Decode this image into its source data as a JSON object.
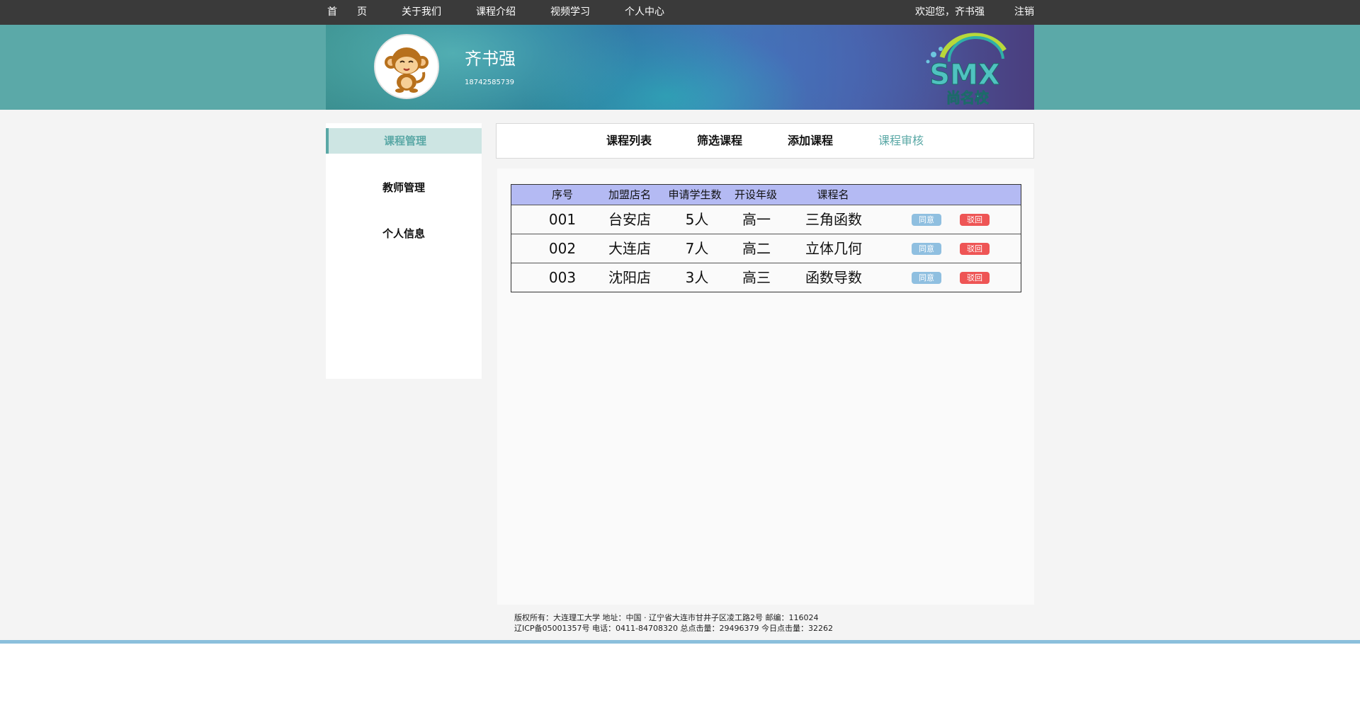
{
  "nav": {
    "items": [
      "首　　页",
      "关于我们",
      "课程介绍",
      "视频学习",
      "个人中心"
    ],
    "welcome": "欢迎您，齐书强",
    "logout": "注销"
  },
  "profile": {
    "name": "齐书强",
    "phone": "18742585739"
  },
  "logo": {
    "text": "SMX",
    "subtitle": "尚名校"
  },
  "sidebar": {
    "items": [
      {
        "label": "课程管理",
        "active": true
      },
      {
        "label": "教师管理",
        "active": false
      },
      {
        "label": "个人信息",
        "active": false
      }
    ]
  },
  "tabs": [
    {
      "label": "课程列表",
      "active": false
    },
    {
      "label": "筛选课程",
      "active": false
    },
    {
      "label": "添加课程",
      "active": false
    },
    {
      "label": "课程审核",
      "active": true
    }
  ],
  "table": {
    "headers": [
      "序号",
      "加盟店名",
      "申请学生数",
      "开设年级",
      "课程名"
    ],
    "rows": [
      [
        "001",
        "台安店",
        "5人",
        "高一",
        "三角函数"
      ],
      [
        "002",
        "大连店",
        "7人",
        "高二",
        "立体几何"
      ],
      [
        "003",
        "沈阳店",
        "3人",
        "高三",
        "函数导数"
      ]
    ],
    "agree_label": "同意",
    "reject_label": "驳回"
  },
  "footer": {
    "line1": "版权所有：大连理工大学  地址：中国 · 辽宁省大连市甘井子区凌工路2号  邮编：116024",
    "line2": "辽ICP备05001357号  电话：0411-84708320 总点击量：29496379 今日点击量：32262"
  },
  "colors": {
    "topbar": "#3a3a3a",
    "accent": "#5aa8a6",
    "table_header": "#b4baf3",
    "agree": "#8fbfe0",
    "reject": "#ee5555"
  }
}
